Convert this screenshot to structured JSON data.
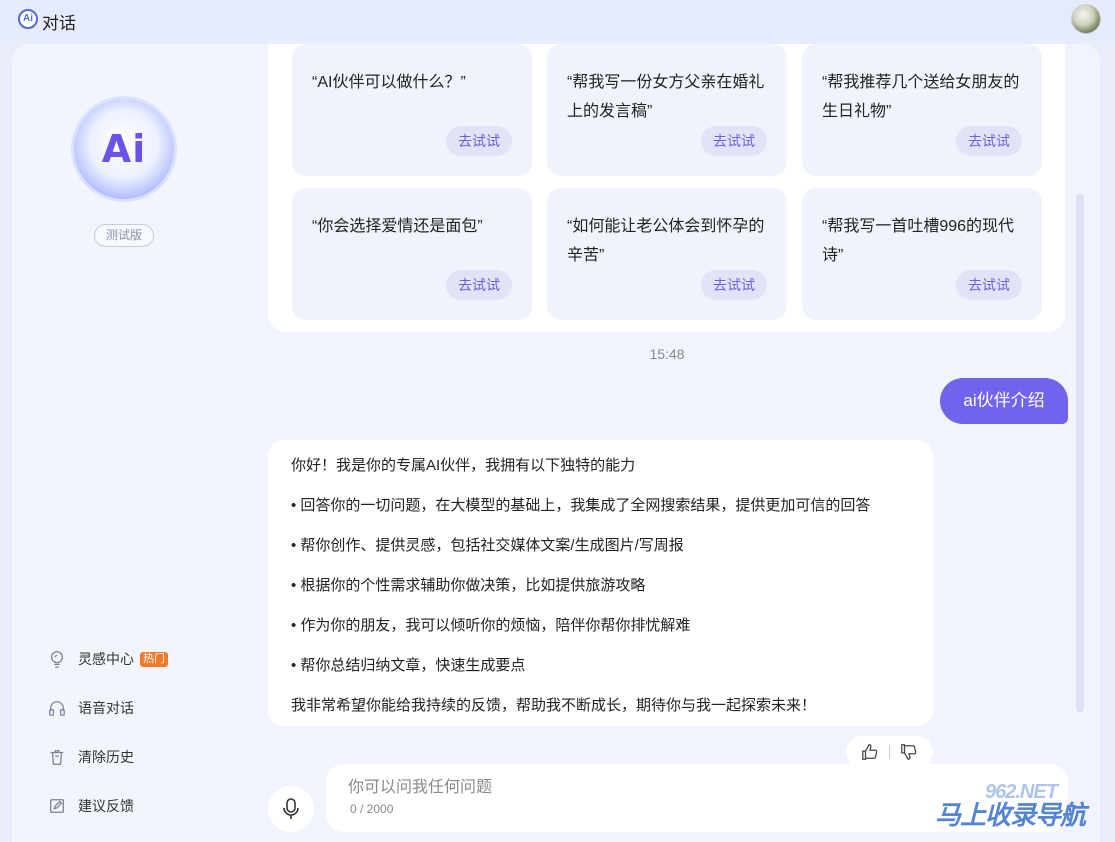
{
  "header": {
    "logo_text": "Ai",
    "title": "对话"
  },
  "sidebar": {
    "orb_text": "Ai",
    "badge": "测试版",
    "items": [
      {
        "label": "灵感中心",
        "icon": "bulb-icon",
        "tag": "热门"
      },
      {
        "label": "语音对话",
        "icon": "headphones-icon"
      },
      {
        "label": "清除历史",
        "icon": "trash-icon"
      },
      {
        "label": "建议反馈",
        "icon": "edit-icon"
      }
    ]
  },
  "prompts": [
    {
      "text": "“AI伙伴可以做什么？”",
      "button": "去试试"
    },
    {
      "text": "“帮我写一份女方父亲在婚礼上的发言稿”",
      "button": "去试试"
    },
    {
      "text": "“帮我推荐几个送给女朋友的生日礼物”",
      "button": "去试试"
    },
    {
      "text": "“你会选择爱情还是面包”",
      "button": "去试试"
    },
    {
      "text": "“如何能让老公体会到怀孕的辛苦”",
      "button": "去试试"
    },
    {
      "text": "“帮我写一首吐槽996的现代诗”",
      "button": "去试试"
    }
  ],
  "chat": {
    "timestamp": "15:48",
    "user_message": "ai伙伴介绍",
    "bot_lines": [
      "你好！我是你的专属AI伙伴，我拥有以下独特的能力",
      "• 回答你的一切问题，在大模型的基础上，我集成了全网搜索结果，提供更加可信的回答",
      "• 帮你创作、提供灵感，包括社交媒体文案/生成图片/写周报",
      "• 根据你的个性需求辅助你做决策，比如提供旅游攻略",
      "• 作为你的朋友，我可以倾听你的烦恼，陪伴你帮你排忧解难",
      "• 帮你总结归纳文章，快速生成要点",
      "我非常希望你能给我持续的反馈，帮助我不断成长，期待你与我一起探索未来！"
    ]
  },
  "input": {
    "placeholder": "你可以问我任何问题",
    "value": "",
    "char_count": "0 / 2000"
  },
  "watermark": {
    "text": "马上收录导航",
    "sub": "962.NET"
  },
  "colors": {
    "accent": "#7164ec",
    "hot_tag": "#f07a2a",
    "background": "#e9edfb"
  }
}
